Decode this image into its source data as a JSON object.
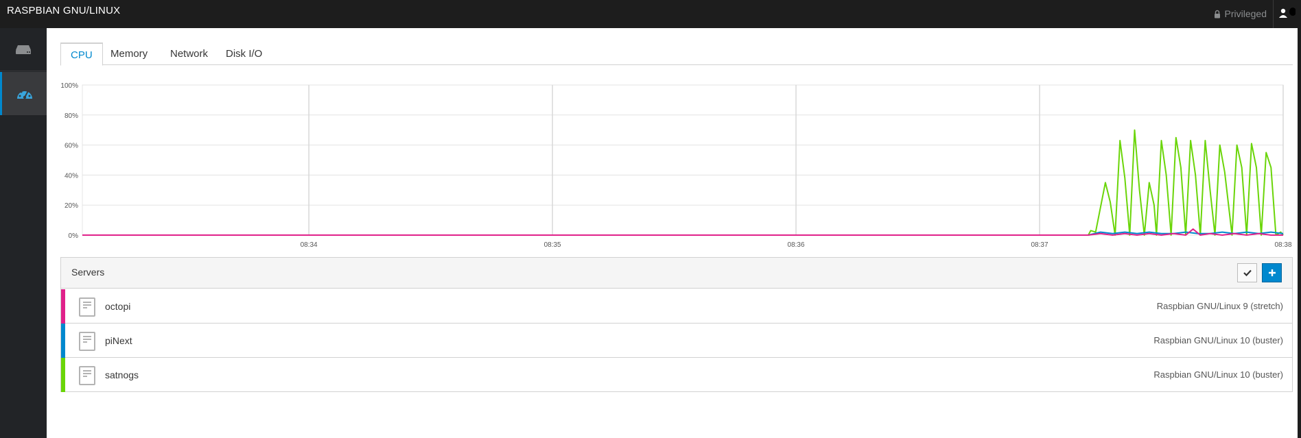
{
  "topbar": {
    "brand": "RASPBIAN GNU/LINUX",
    "privileged_label": "Privileged",
    "lock_icon": "lock-icon",
    "user_icon": "user-icon"
  },
  "sidebar": {
    "items": [
      {
        "icon": "server-icon",
        "active": false
      },
      {
        "icon": "dashboard-gauge-icon",
        "active": true
      }
    ]
  },
  "tabs": [
    {
      "label": "CPU",
      "active": true
    },
    {
      "label": "Memory",
      "active": false
    },
    {
      "label": "Network",
      "active": false
    },
    {
      "label": "Disk I/O",
      "active": false
    }
  ],
  "chart_data": {
    "type": "line",
    "ylim": [
      0,
      100
    ],
    "y_ticks": [
      "0%",
      "20%",
      "40%",
      "60%",
      "80%",
      "100%"
    ],
    "x_ticks": [
      {
        "t": 1,
        "label": "08:34"
      },
      {
        "t": 2,
        "label": "08:35"
      },
      {
        "t": 3,
        "label": "08:36"
      },
      {
        "t": 4,
        "label": "08:37"
      },
      {
        "t": 5,
        "label": "08:38"
      }
    ],
    "xlim": [
      0.07,
      5.0
    ],
    "grid": true,
    "series": [
      {
        "name": "satnogs",
        "color": "#6ad508",
        "x": [
          0.07,
          4.2,
          4.21,
          4.23,
          4.27,
          4.29,
          4.31,
          4.33,
          4.35,
          4.37,
          4.39,
          4.41,
          4.43,
          4.45,
          4.47,
          4.48,
          4.5,
          4.52,
          4.54,
          4.56,
          4.58,
          4.6,
          4.62,
          4.64,
          4.66,
          4.68,
          4.7,
          4.72,
          4.74,
          4.76,
          4.79,
          4.81,
          4.83,
          4.85,
          4.87,
          4.89,
          4.91,
          4.93,
          4.95,
          4.97,
          4.99,
          5.0
        ],
        "y": [
          0,
          0,
          3,
          2,
          35,
          22,
          0,
          63,
          38,
          0,
          70,
          30,
          0,
          35,
          20,
          0,
          63,
          40,
          0,
          65,
          45,
          0,
          63,
          40,
          0,
          63,
          30,
          0,
          60,
          42,
          0,
          60,
          45,
          0,
          61,
          45,
          0,
          55,
          45,
          0,
          2,
          0
        ]
      },
      {
        "name": "piNext",
        "color": "#0088ce",
        "x": [
          4.2,
          4.25,
          4.3,
          4.35,
          4.4,
          4.45,
          4.5,
          4.55,
          4.6,
          4.65,
          4.7,
          4.75,
          4.8,
          4.85,
          4.9,
          4.95,
          5.0
        ],
        "y": [
          0,
          2,
          1,
          2,
          1,
          2,
          1,
          1,
          2,
          1,
          1,
          2,
          1,
          2,
          1,
          2,
          1
        ]
      },
      {
        "name": "octopi",
        "color": "#e0218a",
        "x": [
          0.07,
          4.2,
          4.25,
          4.3,
          4.35,
          4.4,
          4.45,
          4.5,
          4.55,
          4.6,
          4.63,
          4.66,
          4.7,
          4.75,
          4.8,
          4.85,
          4.9,
          4.95,
          5.0
        ],
        "y": [
          0,
          0,
          1,
          0,
          1,
          0,
          1,
          0,
          1,
          0,
          4,
          0,
          1,
          0,
          1,
          0,
          1,
          0,
          0
        ]
      }
    ]
  },
  "servers": {
    "title": "Servers",
    "check_icon": "check-icon",
    "add_icon": "plus-icon",
    "rows": [
      {
        "name": "octopi",
        "os": "Raspbian GNU/Linux 9 (stretch)",
        "color": "#e0218a"
      },
      {
        "name": "piNext",
        "os": "Raspbian GNU/Linux 10 (buster)",
        "color": "#0088ce"
      },
      {
        "name": "satnogs",
        "os": "Raspbian GNU/Linux 10 (buster)",
        "color": "#6ad508"
      }
    ]
  }
}
